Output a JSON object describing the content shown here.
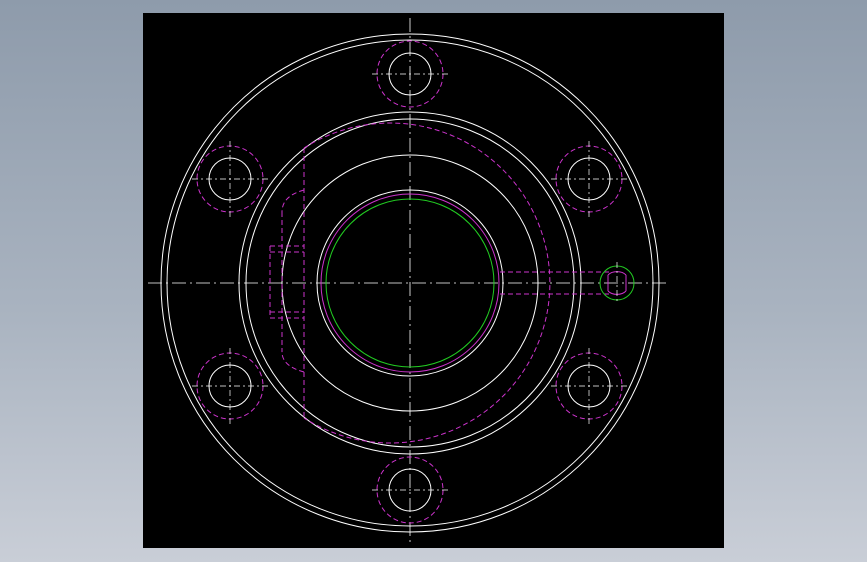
{
  "colors": {
    "viewport_top": "#8e9bab",
    "viewport_bottom": "#c9ced7",
    "canvas": "#000000",
    "outline": "#ffffff",
    "hidden": "#cc33cc",
    "bore": "#22cc22"
  },
  "drawing": {
    "view": "flange-plan-view",
    "bolt_holes": 6,
    "centerlines": true
  }
}
